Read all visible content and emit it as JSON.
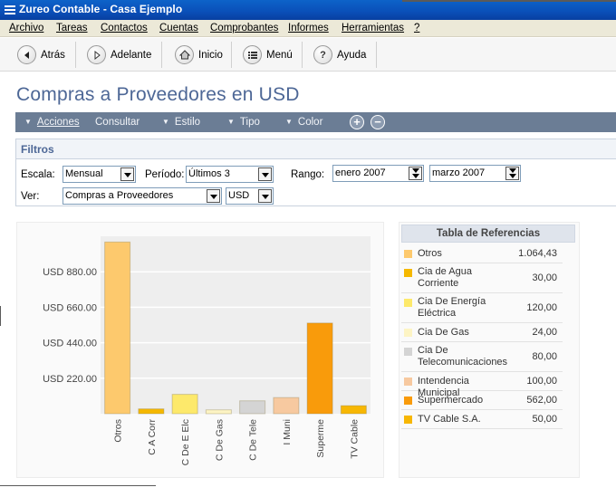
{
  "window": {
    "title": "Zureo Contable - Casa Ejemplo"
  },
  "menu": [
    "Archivo",
    "Tareas",
    "Contactos",
    "Cuentas",
    "Comprobantes",
    "Informes",
    "Herramientas",
    "?"
  ],
  "toolbar": {
    "back": "Atrás",
    "forward": "Adelante",
    "home": "Inicio",
    "menu": "Menú",
    "help": "Ayuda"
  },
  "page": {
    "title": "Compras a Proveedores en USD"
  },
  "actions": {
    "acciones": "Acciones",
    "consultar": "Consultar",
    "estilo": "Estilo",
    "tipo": "Tipo",
    "color": "Color",
    "zoom_in": "+",
    "zoom_out": "−"
  },
  "filters": {
    "header": "Filtros",
    "escala_label": "Escala:",
    "escala_value": "Mensual",
    "periodo_label": "Período:",
    "periodo_value": "Últimos 3",
    "rango_label": "Rango:",
    "rango_from": "enero 2007",
    "rango_to": "marzo 2007",
    "ver_label": "Ver:",
    "ver_value": "Compras a Proveedores",
    "moneda_value": "USD"
  },
  "chart_data": {
    "type": "bar",
    "categories": [
      "Otros",
      "C A Corr",
      "C De E Elc",
      "C De Gas",
      "C De Tele",
      "I Muni",
      "Superme",
      "TV Cable"
    ],
    "values": [
      1064.43,
      30,
      120,
      24,
      80,
      100,
      562,
      50
    ],
    "colors": [
      "#fdc96d",
      "#f5b800",
      "#fde96b",
      "#fdf4c4",
      "#d4d4d4",
      "#f7c9a0",
      "#f99b0b",
      "#f7b704"
    ],
    "y_ticks": [
      220,
      440,
      660,
      880
    ],
    "y_tick_labels": [
      "USD 220.00",
      "USD 440.00",
      "USD 660.00",
      "USD 880.00"
    ],
    "ylim": [
      0,
      1100
    ],
    "grid": true
  },
  "reference_table": {
    "title": "Tabla de Referencias",
    "rows": [
      {
        "name": "Otros",
        "value": "1.064,43",
        "color": "#fdc96d"
      },
      {
        "name": "Cia de Agua Corriente",
        "value": "30,00",
        "color": "#f5b800"
      },
      {
        "name": "Cia De Energía Eléctrica",
        "value": "120,00",
        "color": "#fde96b"
      },
      {
        "name": "Cia De Gas",
        "value": "24,00",
        "color": "#fdf4c4"
      },
      {
        "name": "Cia De Telecomunicaciones",
        "value": "80,00",
        "color": "#d4d4d4"
      },
      {
        "name": "Intendencia Municipal",
        "value": "100,00",
        "color": "#f7c9a0"
      },
      {
        "name": "Supermercado",
        "value": "562,00",
        "color": "#f99b0b"
      },
      {
        "name": "TV Cable S.A.",
        "value": "50,00",
        "color": "#f7b704"
      }
    ]
  }
}
